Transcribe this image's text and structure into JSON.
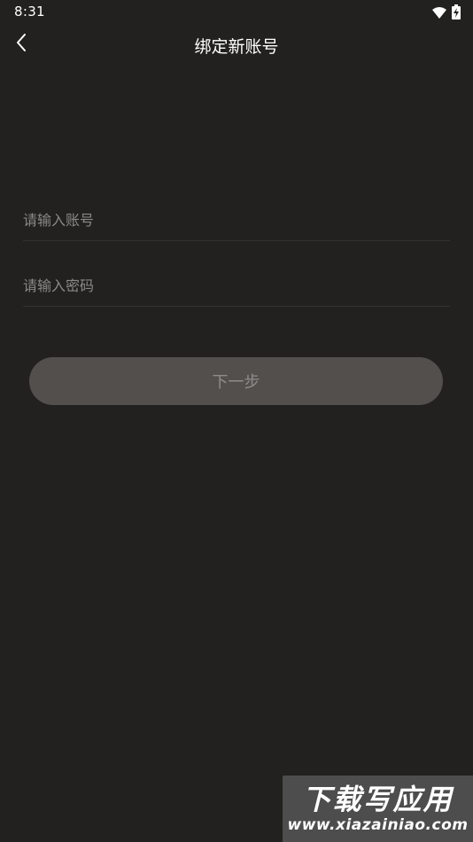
{
  "status_bar": {
    "time": "8:31",
    "icons": [
      "wifi-icon",
      "battery-charging-icon"
    ]
  },
  "app_bar": {
    "back_icon": "chevron-left-icon",
    "title": "绑定新账号"
  },
  "form": {
    "account_placeholder": "请输入账号",
    "account_value": "",
    "password_placeholder": "请输入密码",
    "password_value": "",
    "next_label": "下一步"
  },
  "watermark": {
    "title": "下载写应用",
    "url": "www.xiazainiao.com"
  },
  "colors": {
    "background": "#222120",
    "button": "#524f4d",
    "button_text": "#8f8c8a",
    "placeholder": "#8b8987",
    "divider": "#333231"
  }
}
